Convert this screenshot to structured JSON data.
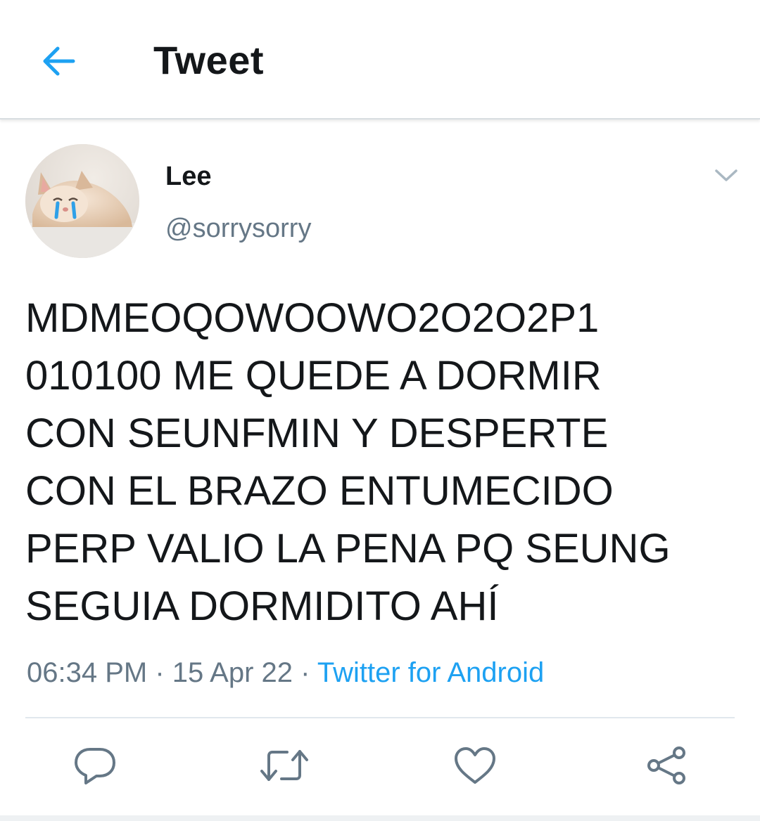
{
  "header": {
    "title": "Tweet",
    "back_icon": "arrow-left-icon"
  },
  "author": {
    "display_name": "Lee",
    "handle": "@sorrysorry",
    "avatar": "crying-cat-avatar"
  },
  "tweet": {
    "text": "MDMEOQOWOOWO2O2O2P1\n010100 ME QUEDE A DORMIR\nCON SEUNFMIN Y DESPERTE\nCON EL BRAZO ENTUMECIDO\nPERP VALIO LA PENA PQ SEUNG\nSEGUIA DORMIDITO AHÍ",
    "time": "06:34 PM",
    "separator": " · ",
    "date": "15 Apr 22",
    "source": "Twitter for Android"
  },
  "actions": {
    "reply_icon": "reply-icon",
    "retweet_icon": "retweet-icon",
    "like_icon": "heart-icon",
    "share_icon": "share-icon"
  },
  "colors": {
    "accent": "#1da1f2",
    "text_primary": "#14171a",
    "text_secondary": "#657786",
    "icon_gray": "#657786"
  }
}
